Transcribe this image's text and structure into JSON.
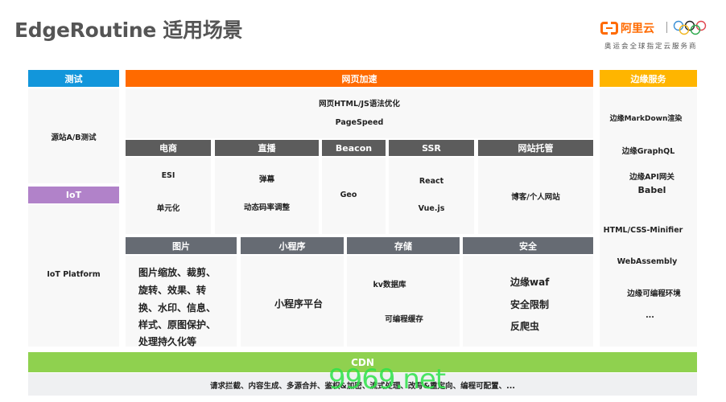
{
  "title": "EdgeRoutine 适用场景",
  "logo": {
    "brand_name": "阿里云",
    "subtitle": "奥运会全球指定云服务商"
  },
  "colors": {
    "test": "#1296db",
    "iot": "#b182c9",
    "web_accel": "#ff6a00",
    "edge_service": "#ffb500",
    "sub_header": "#5c5c5c",
    "sub_header2": "#666b73",
    "cdn": "#8fd14f"
  },
  "left": {
    "test": {
      "header": "测试",
      "items": [
        "源站A/B测试"
      ]
    },
    "iot": {
      "header": "IoT",
      "items": [
        "IoT Platform"
      ]
    }
  },
  "web_accel": {
    "header": "网页加速",
    "items": [
      "网页HTML/JS语法优化",
      "PageSpeed"
    ],
    "row1": [
      {
        "header": "电商",
        "items": [
          "ESI",
          "单元化"
        ]
      },
      {
        "header": "直播",
        "items": [
          "弹幕",
          "动态码率调整"
        ]
      },
      {
        "header": "Beacon",
        "items": [
          "Geo"
        ]
      },
      {
        "header": "SSR",
        "items": [
          "React",
          "Vue.js"
        ]
      },
      {
        "header": "网站托管",
        "items": [
          "博客/个人网站"
        ]
      }
    ],
    "row2": [
      {
        "header": "图片",
        "items": [
          "图片缩放、裁剪、",
          "旋转、效果、转",
          "换、水印、信息、",
          "样式、原图保护、",
          "处理持久化等"
        ]
      },
      {
        "header": "小程序",
        "items": [
          "小程序平台"
        ]
      },
      {
        "header": "存储",
        "items": [
          "kv数据库",
          "可编程缓存"
        ]
      },
      {
        "header": "安全",
        "items": [
          "边缘waf",
          "安全限制",
          "反爬虫"
        ]
      }
    ]
  },
  "edge_service": {
    "header": "边缘服务",
    "items": [
      "边缘MarkDown渲染",
      "边缘GraphQL",
      "边缘API网关",
      "Babel",
      "HTML/CSS-Minifier",
      "WebAssembly",
      "边缘可编程环境",
      "..."
    ]
  },
  "cdn": {
    "header": "CDN",
    "description": "请求拦截、内容生成、多源合并、鉴权&加密、流式处理、改写&重定向、编程可配置、..."
  },
  "watermark": "9969.net"
}
